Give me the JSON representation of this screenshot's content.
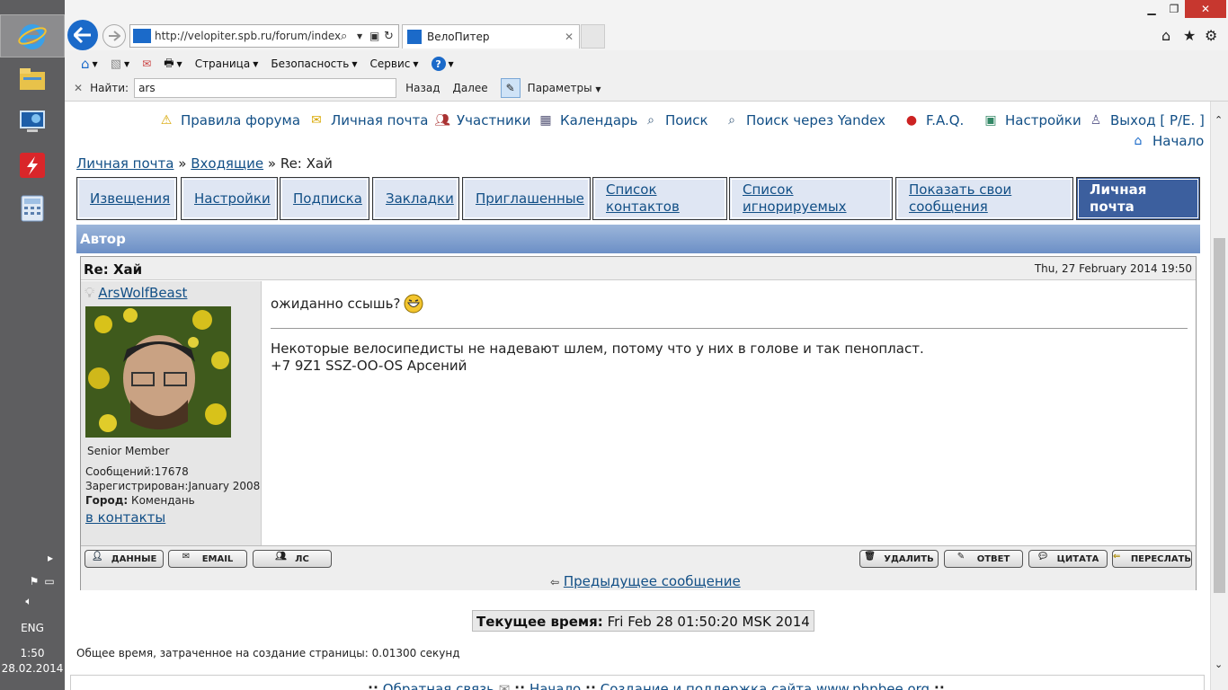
{
  "taskbar": {
    "apps": [
      {
        "name": "ie-icon"
      },
      {
        "name": "file-explorer-icon"
      },
      {
        "name": "remote-desktop-icon"
      },
      {
        "name": "flash-icon"
      },
      {
        "name": "calculator-icon"
      }
    ],
    "language": "ENG",
    "time": "1:50",
    "date": "28.02.2014"
  },
  "browser": {
    "url": "http://velopiter.spb.ru/forum/index.ph",
    "tab_title": "ВелоПитер",
    "commands": [
      "Страница",
      "Безопасность",
      "Сервис"
    ],
    "find": {
      "label": "Найти:",
      "value": "ars",
      "prev": "Назад",
      "next": "Далее",
      "options": "Параметры"
    }
  },
  "topnav": {
    "rules": "Правила форума",
    "pm": "Личная почта",
    "members": "Участники",
    "calendar": "Календарь",
    "search": "Поиск",
    "yandex": "Поиск через Yandex",
    "faq": "F.A.Q.",
    "settings": "Настройки",
    "logout": "Выход [ P/E. ]",
    "home": "Начало"
  },
  "breadcrumb": {
    "pm": "Личная почта",
    "sep1": "»",
    "inbox": "Входящие",
    "sep2": "»",
    "current": "Re: Хай"
  },
  "pmtabs": [
    "Извещения",
    "Настройки",
    "Подписка",
    "Закладки",
    "Приглашенные",
    "Список контактов",
    "Список игнорируемых",
    "Показать свои сообщения",
    "Личная почта"
  ],
  "author_header": "Автор",
  "message": {
    "title": "Re: Хай",
    "date": "Thu, 27 February 2014 19:50",
    "author": "ArsWolfBeast",
    "rank": "Senior Member",
    "posts_label": "Сообщений:",
    "posts": "17678",
    "registered_label": "Зарегистрирован:",
    "registered": "January 2008",
    "city_label": "Город:",
    "city": "Комендань",
    "to_contacts": "в контакты",
    "body": "ожиданно ссышь?",
    "signature_line1": "Некоторые велосипедисты не надевают шлем, потому что у них в голове и так пенопласт.",
    "signature_line2": "+7 9Z1 SSZ-OO-OS Арсений",
    "buttons_left": [
      "ДАННЫЕ",
      "EMAIL",
      "ЛС"
    ],
    "buttons_right": [
      "УДАЛИТЬ",
      "ОТВЕТ",
      "ЦИТАТА",
      "ПЕРЕСЛАТЬ"
    ],
    "prev_message": "Предыдущее сообщение"
  },
  "current_time": {
    "label": "Текущее время:",
    "value": "Fri Feb 28 01:50:20 MSK 2014"
  },
  "gen_time": "Общее время, затраченное на создание страницы: 0.01300 секунд",
  "footer": {
    "feedback": "Обратная связь",
    "home": "Начало",
    "credits": "Создание и поддержка сайта www.phpbee.org"
  }
}
